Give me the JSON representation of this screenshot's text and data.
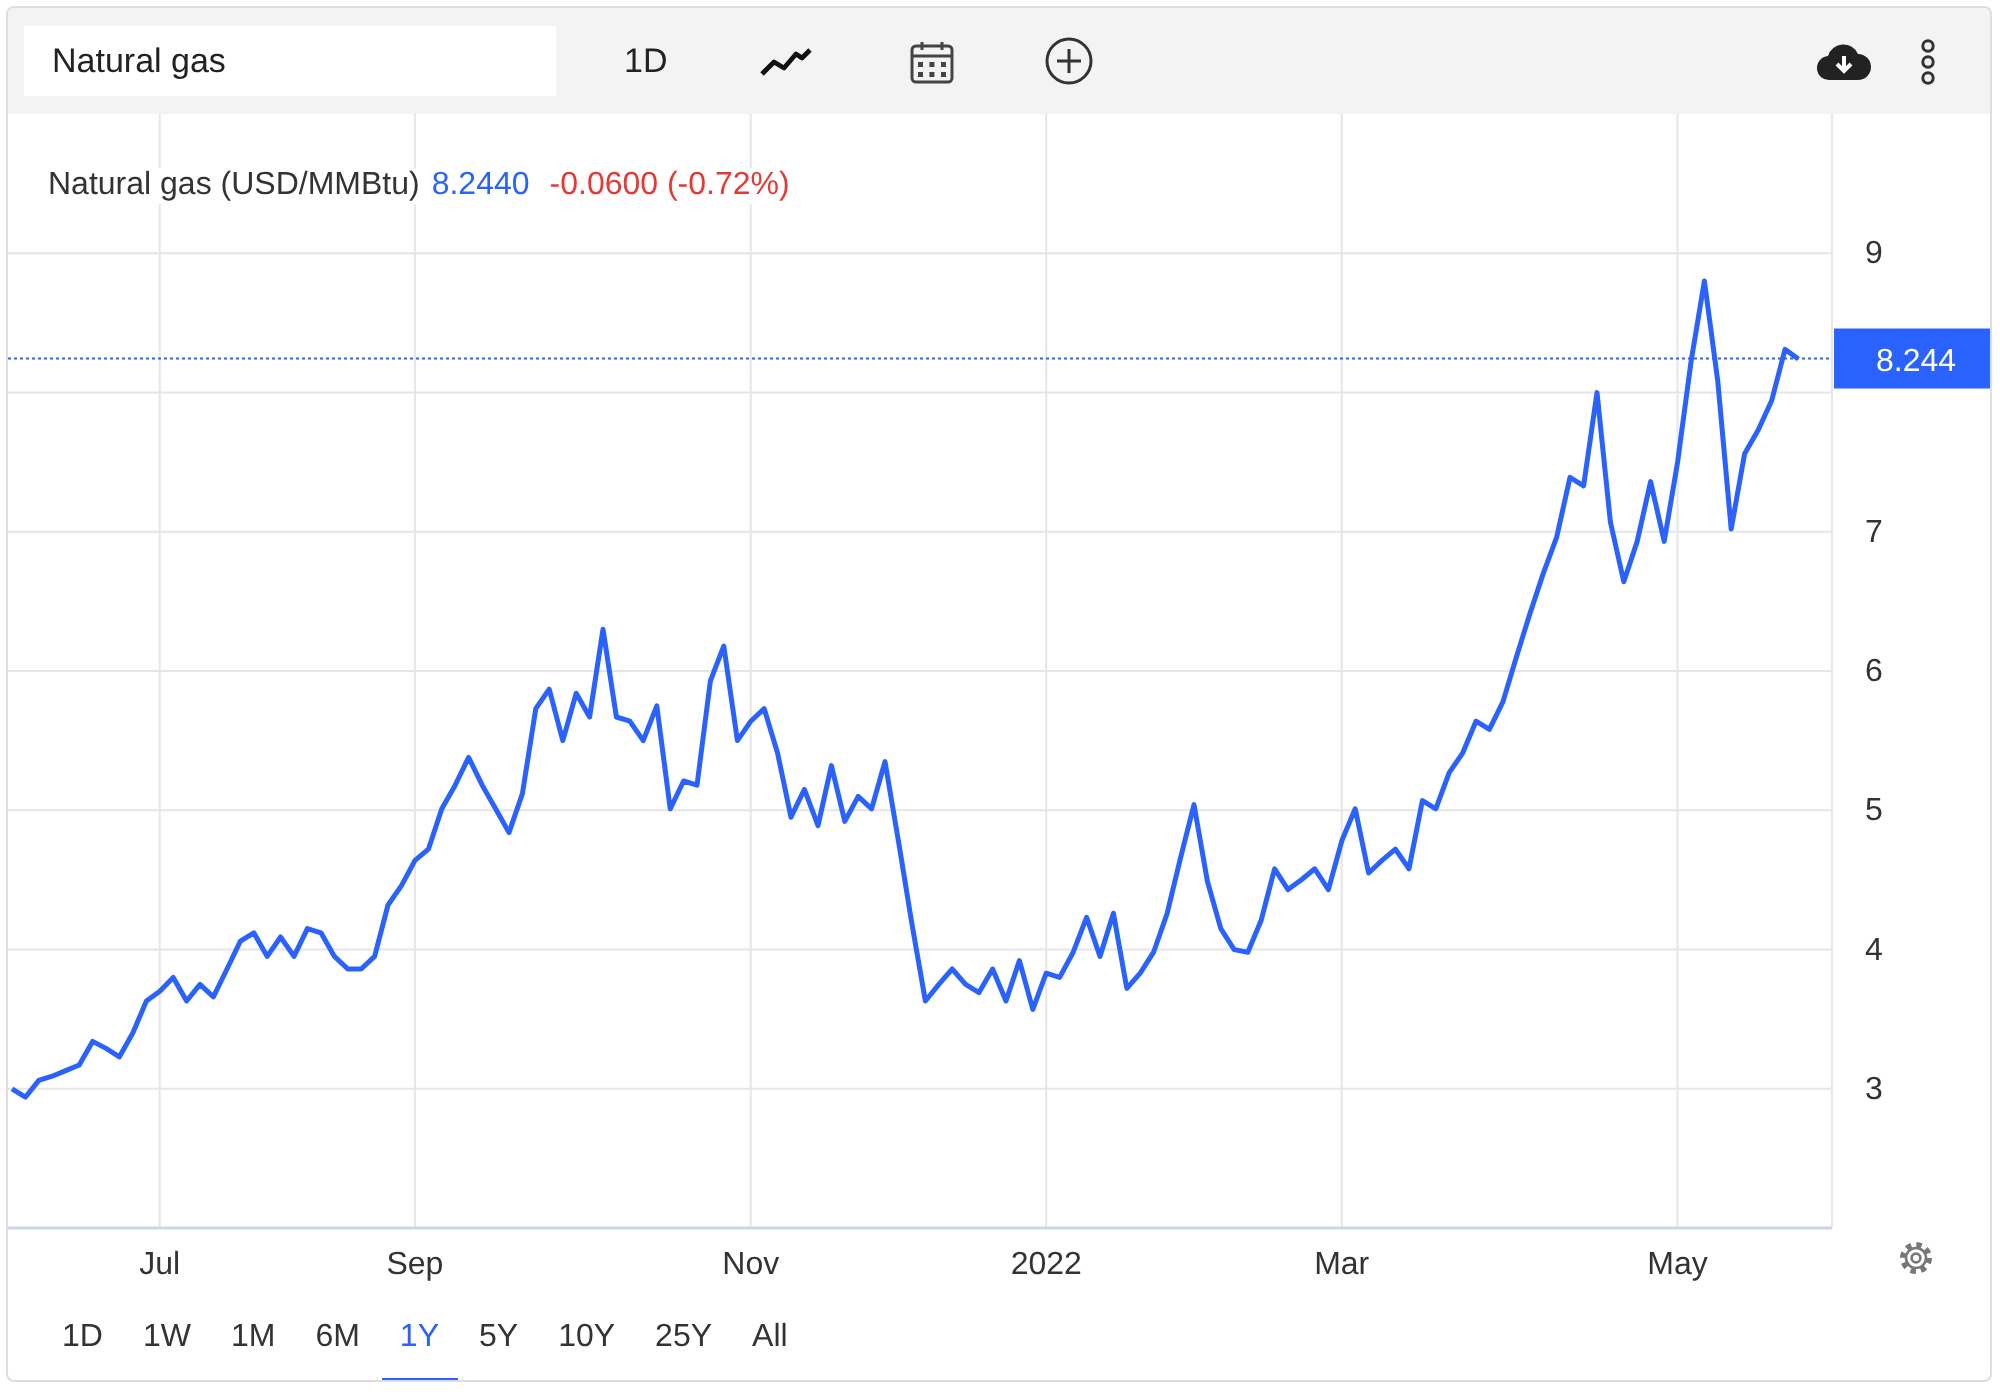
{
  "toolbar": {
    "search": {
      "value": "Natural gas"
    },
    "interval": "1D"
  },
  "legend": {
    "name": "Natural gas (USD/MMBtu)",
    "price": "8.2440",
    "change": "-0.0600 (-0.72%)"
  },
  "price_tag": "8.244",
  "chart_data": {
    "type": "line",
    "ylim": [
      2,
      10
    ],
    "grid": true,
    "ref_lines": [
      {
        "axis": "y",
        "value": 8.244,
        "color": "#2962ff"
      }
    ],
    "categories": [
      null,
      null,
      null,
      null,
      null,
      null,
      null,
      null,
      null,
      null,
      null,
      "Jul",
      null,
      null,
      null,
      null,
      null,
      null,
      null,
      null,
      null,
      null,
      null,
      null,
      null,
      null,
      null,
      null,
      null,
      null,
      "Sep",
      null,
      null,
      null,
      null,
      null,
      null,
      null,
      null,
      null,
      null,
      null,
      null,
      null,
      null,
      null,
      null,
      null,
      null,
      null,
      null,
      null,
      null,
      null,
      null,
      "Nov",
      null,
      null,
      null,
      null,
      null,
      null,
      null,
      null,
      null,
      null,
      null,
      null,
      null,
      null,
      null,
      null,
      null,
      null,
      null,
      null,
      null,
      "2022",
      null,
      null,
      null,
      null,
      null,
      null,
      null,
      null,
      null,
      null,
      null,
      null,
      null,
      null,
      null,
      null,
      null,
      null,
      null,
      null,
      null,
      "Mar",
      null,
      null,
      null,
      null,
      null,
      null,
      null,
      null,
      null,
      null,
      null,
      null,
      null,
      null,
      null,
      null,
      null,
      null,
      null,
      null,
      null,
      null,
      null,
      null,
      "May",
      null,
      null,
      null,
      null,
      null,
      null,
      null,
      null,
      null
    ],
    "series": [
      {
        "color": "#2962ff",
        "values": [
          3.0,
          2.94,
          3.06,
          3.09,
          3.13,
          3.17,
          3.34,
          3.29,
          3.23,
          3.4,
          3.63,
          3.7,
          3.8,
          3.63,
          3.75,
          3.66,
          3.86,
          4.06,
          4.12,
          3.95,
          4.09,
          3.95,
          4.15,
          4.12,
          3.95,
          3.86,
          3.86,
          3.95,
          4.32,
          4.46,
          4.64,
          4.72,
          5.01,
          5.18,
          5.38,
          5.18,
          5.01,
          4.84,
          5.12,
          5.73,
          5.87,
          5.5,
          5.84,
          5.67,
          6.3,
          5.67,
          5.64,
          5.5,
          5.75,
          5.01,
          5.21,
          5.18,
          5.93,
          6.18,
          5.5,
          5.64,
          5.73,
          5.41,
          4.95,
          5.15,
          4.89,
          5.32,
          4.92,
          5.1,
          5.01,
          5.35,
          4.78,
          4.18,
          3.63,
          3.75,
          3.86,
          3.75,
          3.69,
          3.86,
          3.63,
          3.92,
          3.57,
          3.83,
          3.8,
          3.98,
          4.23,
          3.95,
          4.26,
          3.72,
          3.83,
          3.98,
          4.26,
          4.66,
          5.04,
          4.49,
          4.15,
          4.0,
          3.98,
          4.21,
          4.58,
          4.43,
          4.5,
          4.58,
          4.43,
          4.78,
          5.01,
          4.55,
          4.64,
          4.72,
          4.58,
          5.07,
          5.01,
          5.27,
          5.41,
          5.64,
          5.58,
          5.78,
          6.1,
          6.41,
          6.7,
          6.96,
          7.39,
          7.33,
          8.0,
          7.07,
          6.64,
          6.93,
          7.36,
          6.93,
          7.5,
          8.22,
          8.8,
          8.08,
          7.02,
          7.56,
          7.73,
          7.94,
          8.31,
          8.24
        ]
      }
    ],
    "yticks": [
      3,
      4,
      5,
      6,
      7,
      9
    ]
  },
  "ranges": [
    {
      "label": "1D",
      "selected": false
    },
    {
      "label": "1W",
      "selected": false
    },
    {
      "label": "1M",
      "selected": false
    },
    {
      "label": "6M",
      "selected": false
    },
    {
      "label": "1Y",
      "selected": true
    },
    {
      "label": "5Y",
      "selected": false
    },
    {
      "label": "10Y",
      "selected": false
    },
    {
      "label": "25Y",
      "selected": false
    },
    {
      "label": "All",
      "selected": false
    }
  ]
}
